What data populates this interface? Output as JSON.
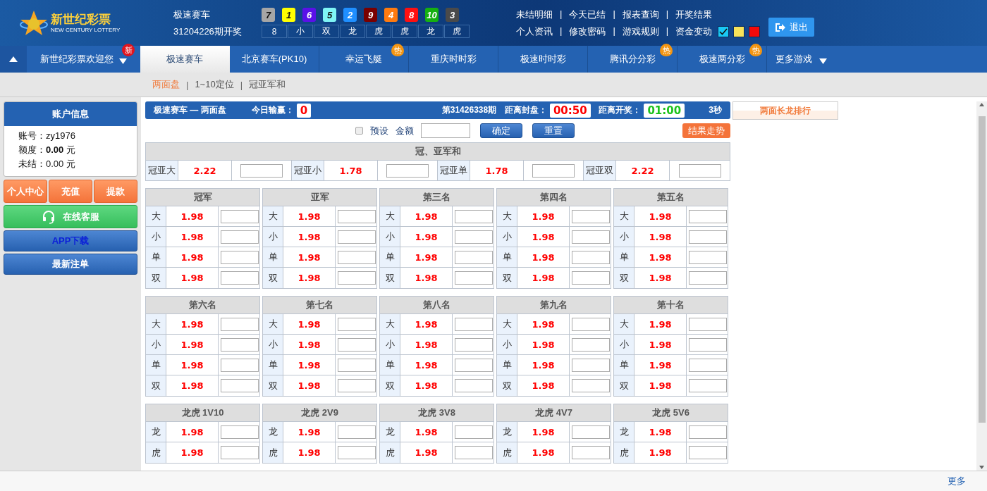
{
  "header": {
    "logo": {
      "name": "新世纪彩票",
      "subtitle": "NEW CENTURY LOTTERY"
    },
    "draw": {
      "game": "极速赛车",
      "issue": "31204226期开奖",
      "balls": [
        {
          "number": "7",
          "color": "#a6a6a6"
        },
        {
          "number": "1",
          "color": "#ffff00"
        },
        {
          "number": "6",
          "color": "#5a10e8"
        },
        {
          "number": "5",
          "color": "#7ff5f5"
        },
        {
          "number": "2",
          "color": "#1f8fff"
        },
        {
          "number": "9",
          "color": "#7a0000"
        },
        {
          "number": "4",
          "color": "#ff7a10"
        },
        {
          "number": "8",
          "color": "#ff1010"
        },
        {
          "number": "10",
          "color": "#16b010"
        },
        {
          "number": "3",
          "color": "#4a4a4a"
        }
      ],
      "results": [
        "8",
        "小",
        "双",
        "龙",
        "虎",
        "虎",
        "龙",
        "虎"
      ]
    },
    "link_separator": "|",
    "links": [
      [
        "未结明细",
        "今天已结",
        "报表查询",
        "开奖结果"
      ],
      [
        "个人资讯",
        "修改密码",
        "游戏规则",
        "资金变动"
      ]
    ],
    "themes": [
      {
        "color": "#19c8f5",
        "selected": true
      },
      {
        "color": "#f7e35a",
        "selected": false
      },
      {
        "color": "#f50a0a",
        "selected": false
      }
    ],
    "logout": "退出"
  },
  "nav": {
    "welcome": {
      "label": "新世纪彩票欢迎您",
      "badge": "新"
    },
    "tabs": [
      {
        "label": "极速赛车",
        "selected": true
      },
      {
        "label": "北京赛车(PK10)",
        "selected": false
      },
      {
        "label": "幸运飞艇",
        "selected": false,
        "badge": "热"
      },
      {
        "label": "重庆时时彩",
        "selected": false
      },
      {
        "label": "极速时时彩",
        "selected": false
      },
      {
        "label": "腾讯分分彩",
        "selected": false,
        "badge": "热"
      },
      {
        "label": "极速两分彩",
        "selected": false,
        "badge": "热"
      }
    ],
    "more": "更多游戏"
  },
  "subtab_separator": "|",
  "subtabs": [
    {
      "label": "两面盘",
      "selected": true
    },
    {
      "label": "1~10定位",
      "selected": false
    },
    {
      "label": "冠亚军和",
      "selected": false
    }
  ],
  "sidebar": {
    "account_title": "账户信息",
    "account_lines": [
      "账号：zy1976",
      "额度：**0.00** 元",
      "未结：0.00 元"
    ],
    "quick_buttons": [
      "个人中心",
      "充值",
      "提款"
    ],
    "service": "在线客服",
    "app": "APP下载",
    "latest": "最新注单"
  },
  "status": {
    "title": "极速赛车 — 两面盘",
    "profit_label": "今日输赢：",
    "profit": "0",
    "period": "第31426338期",
    "close_label": "距离封盘：",
    "close_time": "00:50",
    "open_label": "距离开奖：",
    "open_time": "01:00",
    "refresh": "3秒"
  },
  "ranking": "两面长龙排行",
  "controls": {
    "preset_label": "预设",
    "preset_checked": false,
    "amount_label": "金额",
    "confirm": "确定",
    "reset": "重置",
    "trend": "结果走势"
  },
  "sum_table": {
    "title": "冠、亚军和",
    "cells": [
      {
        "label": "冠亚大",
        "odds": "2.22"
      },
      {
        "label": "冠亚小",
        "odds": "1.78"
      },
      {
        "label": "冠亚单",
        "odds": "1.78"
      },
      {
        "label": "冠亚双",
        "odds": "2.22"
      }
    ]
  },
  "groups": [
    {
      "title": "冠军",
      "rows": [
        {
          "label": "大",
          "odds": "1.98"
        },
        {
          "label": "小",
          "odds": "1.98"
        },
        {
          "label": "单",
          "odds": "1.98"
        },
        {
          "label": "双",
          "odds": "1.98"
        }
      ]
    },
    {
      "title": "亚军",
      "rows": [
        {
          "label": "大",
          "odds": "1.98"
        },
        {
          "label": "小",
          "odds": "1.98"
        },
        {
          "label": "单",
          "odds": "1.98"
        },
        {
          "label": "双",
          "odds": "1.98"
        }
      ]
    },
    {
      "title": "第三名",
      "rows": [
        {
          "label": "大",
          "odds": "1.98"
        },
        {
          "label": "小",
          "odds": "1.98"
        },
        {
          "label": "单",
          "odds": "1.98"
        },
        {
          "label": "双",
          "odds": "1.98"
        }
      ]
    },
    {
      "title": "第四名",
      "rows": [
        {
          "label": "大",
          "odds": "1.98"
        },
        {
          "label": "小",
          "odds": "1.98"
        },
        {
          "label": "单",
          "odds": "1.98"
        },
        {
          "label": "双",
          "odds": "1.98"
        }
      ]
    },
    {
      "title": "第五名",
      "rows": [
        {
          "label": "大",
          "odds": "1.98"
        },
        {
          "label": "小",
          "odds": "1.98"
        },
        {
          "label": "单",
          "odds": "1.98"
        },
        {
          "label": "双",
          "odds": "1.98"
        }
      ]
    },
    {
      "title": "第六名",
      "rows": [
        {
          "label": "大",
          "odds": "1.98"
        },
        {
          "label": "小",
          "odds": "1.98"
        },
        {
          "label": "单",
          "odds": "1.98"
        },
        {
          "label": "双",
          "odds": "1.98"
        }
      ]
    },
    {
      "title": "第七名",
      "rows": [
        {
          "label": "大",
          "odds": "1.98"
        },
        {
          "label": "小",
          "odds": "1.98"
        },
        {
          "label": "单",
          "odds": "1.98"
        },
        {
          "label": "双",
          "odds": "1.98"
        }
      ]
    },
    {
      "title": "第八名",
      "rows": [
        {
          "label": "大",
          "odds": "1.98"
        },
        {
          "label": "小",
          "odds": "1.98"
        },
        {
          "label": "单",
          "odds": "1.98"
        },
        {
          "label": "双",
          "odds": "1.98"
        }
      ]
    },
    {
      "title": "第九名",
      "rows": [
        {
          "label": "大",
          "odds": "1.98"
        },
        {
          "label": "小",
          "odds": "1.98"
        },
        {
          "label": "单",
          "odds": "1.98"
        },
        {
          "label": "双",
          "odds": "1.98"
        }
      ]
    },
    {
      "title": "第十名",
      "rows": [
        {
          "label": "大",
          "odds": "1.98"
        },
        {
          "label": "小",
          "odds": "1.98"
        },
        {
          "label": "单",
          "odds": "1.98"
        },
        {
          "label": "双",
          "odds": "1.98"
        }
      ]
    },
    {
      "title": "龙虎 1V10",
      "rows": [
        {
          "label": "龙",
          "odds": "1.98"
        },
        {
          "label": "虎",
          "odds": "1.98"
        }
      ]
    },
    {
      "title": "龙虎 2V9",
      "rows": [
        {
          "label": "龙",
          "odds": "1.98"
        },
        {
          "label": "虎",
          "odds": "1.98"
        }
      ]
    },
    {
      "title": "龙虎 3V8",
      "rows": [
        {
          "label": "龙",
          "odds": "1.98"
        },
        {
          "label": "虎",
          "odds": "1.98"
        }
      ]
    },
    {
      "title": "龙虎 4V7",
      "rows": [
        {
          "label": "龙",
          "odds": "1.98"
        },
        {
          "label": "虎",
          "odds": "1.98"
        }
      ]
    },
    {
      "title": "龙虎 5V6",
      "rows": [
        {
          "label": "龙",
          "odds": "1.98"
        },
        {
          "label": "虎",
          "odds": "1.98"
        }
      ]
    }
  ],
  "footer": {
    "more": "更多"
  }
}
